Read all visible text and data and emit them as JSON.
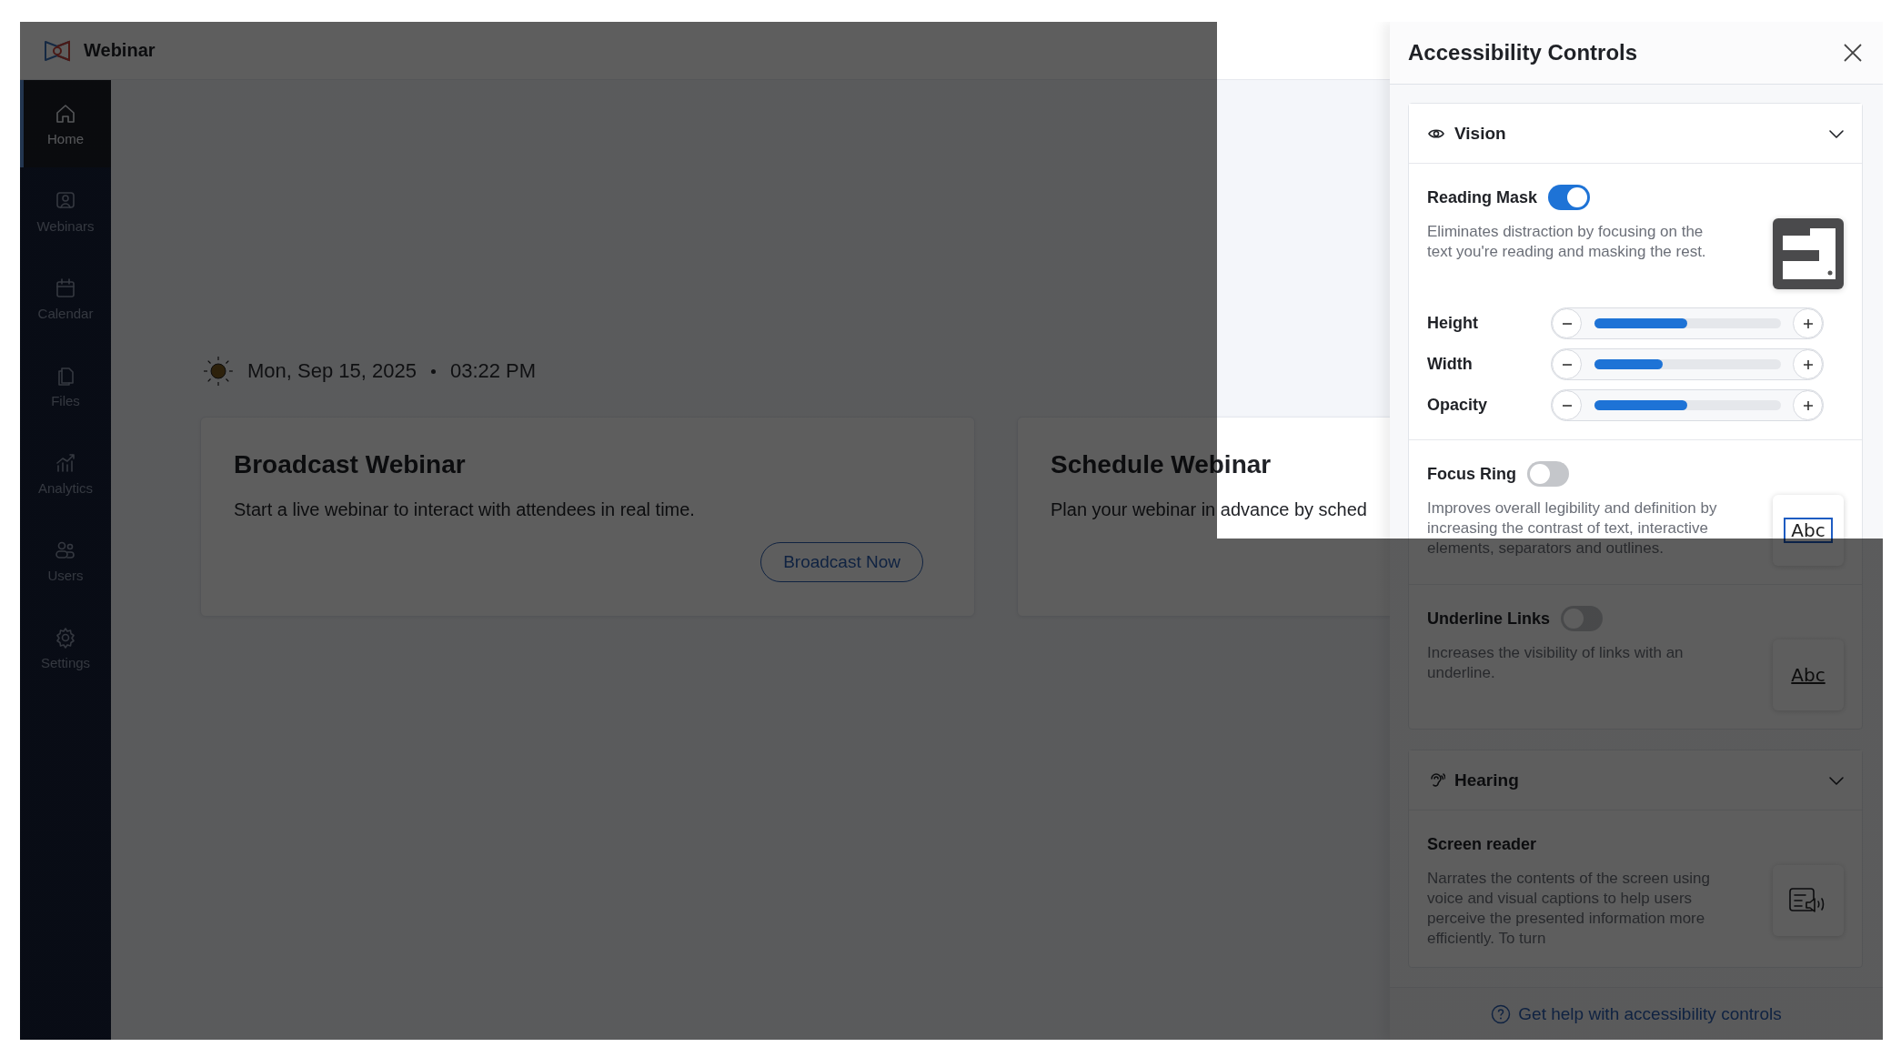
{
  "app": {
    "title": "Webinar"
  },
  "sidebar": {
    "items": [
      {
        "label": "Home",
        "selected": true
      },
      {
        "label": "Webinars",
        "selected": false
      },
      {
        "label": "Calendar",
        "selected": false
      },
      {
        "label": "Files",
        "selected": false
      },
      {
        "label": "Analytics",
        "selected": false
      },
      {
        "label": "Users",
        "selected": false
      },
      {
        "label": "Settings",
        "selected": false
      }
    ]
  },
  "greeting": {
    "date": "Mon, Sep 15, 2025",
    "time": "03:22 PM"
  },
  "cards": [
    {
      "title": "Broadcast Webinar",
      "description": "Start a live webinar to interact with attendees in real time.",
      "button": "Broadcast Now"
    },
    {
      "title": "Schedule Webinar",
      "description": "Plan your webinar in advance by sched"
    }
  ],
  "panel": {
    "title": "Accessibility Controls",
    "sections": [
      {
        "title": "Vision",
        "expanded": true,
        "features": [
          {
            "kind": "toggle",
            "title": "Reading Mask",
            "on": true,
            "description": "Eliminates distraction by focusing on the text you're reading and masking the rest.",
            "sliders": [
              {
                "label": "Height",
                "level": 0.5
              },
              {
                "label": "Width",
                "level": 0.37
              },
              {
                "label": "Opacity",
                "level": 0.5
              }
            ]
          },
          {
            "kind": "toggle",
            "title": "Focus Ring",
            "on": false,
            "description": "Improves overall legibility and definition by increasing the contrast of text, interactive elements, separators and outlines.",
            "preview_text": "Abc"
          },
          {
            "kind": "toggle",
            "title": "Underline Links",
            "on": false,
            "description": "Increases the visibility of links with an underline.",
            "preview_text": "Abc"
          }
        ]
      },
      {
        "title": "Hearing",
        "expanded": true,
        "features": [
          {
            "kind": "plain",
            "title": "Screen reader",
            "description": "Narrates the contents of the screen using voice and visual captions to help users perceive the presented information more efficiently. To turn"
          }
        ]
      }
    ],
    "help_link": "Get help with accessibility controls"
  },
  "reading_mask": {
    "on": true
  }
}
